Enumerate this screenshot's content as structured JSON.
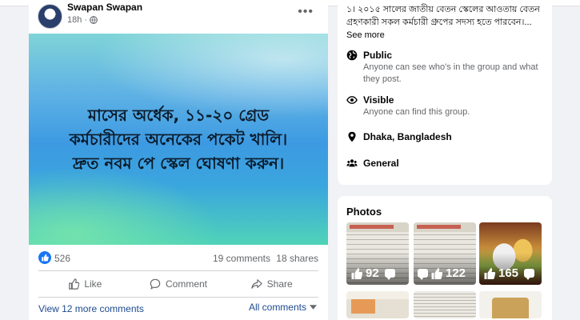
{
  "post": {
    "author": "Swapan Swapan",
    "time": "18h",
    "more": "•••",
    "image_text": [
      "মাসের অর্ধেক, ১১-২০ গ্রেড",
      "কর্মচারীদের অনেকের পকেট খালি।",
      "দ্রুত নবম পে স্কেল ঘোষণা করুন।"
    ],
    "reaction_count": "526",
    "comments_count": "19 comments",
    "shares_count": "18 shares",
    "actions": {
      "like": "Like",
      "comment": "Comment",
      "share": "Share"
    },
    "view_more": "View 12 more comments",
    "all_comments": "All comments"
  },
  "about": {
    "description": "১। ২০১৫ সালের জাতীয় বেতন স্কেলের আওতায় বেতন গ্রহণকারী সকল কর্মচারী গ্রুপের সদস্য হতে পারবেন।...",
    "see_more": "See more",
    "public": {
      "title": "Public",
      "sub": "Anyone can see who's in the group and what they post."
    },
    "visible": {
      "title": "Visible",
      "sub": "Anyone can find this group."
    },
    "location": {
      "title": "Dhaka, Bangladesh"
    },
    "category": {
      "title": "General"
    }
  },
  "photos": {
    "title": "Photos",
    "items": [
      {
        "likes": "92"
      },
      {
        "likes": "122"
      },
      {
        "likes": "165"
      }
    ]
  },
  "colors": {
    "facebook_blue": "#1877f2",
    "link": "#1c4a8f",
    "secondary_text": "#65676b"
  }
}
